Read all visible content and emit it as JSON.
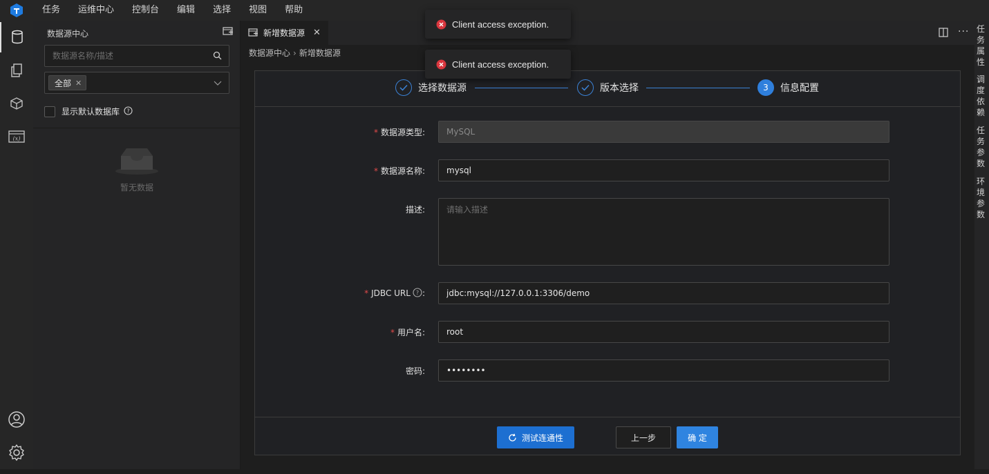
{
  "menubar": {
    "items": [
      "任务",
      "运维中心",
      "控制台",
      "编辑",
      "选择",
      "视图",
      "帮助"
    ]
  },
  "activitybar": {
    "icons": [
      "datasource-icon",
      "files-icon",
      "package-icon",
      "variable-icon",
      "account-icon",
      "settings-icon"
    ]
  },
  "sidebar": {
    "title": "数据源中心",
    "search_placeholder": "数据源名称/描述",
    "filter_tag": "全部",
    "checkbox_label": "显示默认数据库",
    "empty_text": "暂无数据"
  },
  "editor": {
    "tab_label": "新增数据源",
    "breadcrumb": [
      "数据源中心",
      "新增数据源"
    ],
    "steps": [
      {
        "label": "选择数据源",
        "state": "done"
      },
      {
        "label": "版本选择",
        "state": "done"
      },
      {
        "number": "3",
        "label": "信息配置",
        "state": "active"
      }
    ],
    "form": {
      "type_label": "数据源类型",
      "type_value": "MySQL",
      "name_label": "数据源名称",
      "name_value": "mysql",
      "desc_label": "描述",
      "desc_placeholder": "请输入描述",
      "jdbc_label": "JDBC URL",
      "jdbc_value": "jdbc:mysql://127.0.0.1:3306/demo",
      "user_label": "用户名",
      "user_value": "root",
      "password_label": "密码",
      "password_value": "••••••••",
      "colon": ":",
      "required_mark": "*"
    },
    "buttons": {
      "test": "测试连通性",
      "prev": "上一步",
      "ok": "确 定"
    }
  },
  "rightbar": {
    "items": [
      "任务属性",
      "调度依赖",
      "任务参数",
      "环境参数"
    ]
  },
  "toasts": [
    {
      "text": "Client access exception."
    },
    {
      "text": "Client access exception."
    }
  ],
  "colors": {
    "accent": "#2f7fdc",
    "error": "#d9363e",
    "required": "#e04a4a"
  }
}
